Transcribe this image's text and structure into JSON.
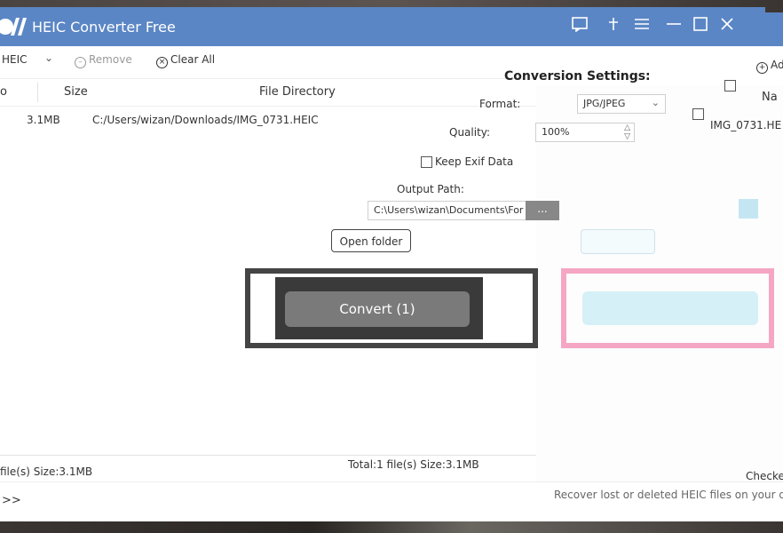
{
  "window": {
    "title": "HEIC Converter Free",
    "controls": [
      "feedback-icon",
      "pin-icon",
      "menu-icon",
      "minimize-icon",
      "maximize-icon",
      "close-icon"
    ]
  },
  "toolbar": {
    "format": "HEIC",
    "remove_label": "Remove",
    "clear_all_label": "Clear All",
    "add_file_label": "Ad"
  },
  "file_list": {
    "columns": [
      "o",
      "Size",
      "File Directory"
    ],
    "rows": [
      {
        "size": "3.1MB",
        "directory": "C:/Users/wizan/Downloads/IMG_0731.HEIC"
      }
    ]
  },
  "ghost_list": {
    "name_header": "Na",
    "row_name": "IMG_0731.HE"
  },
  "settings": {
    "title": "Conversion Settings:",
    "format_label": "Format:",
    "format_value": "JPG/JPEG",
    "quality_label": "Quality:",
    "quality_value": "100%",
    "keep_exif_label": "Keep Exif Data",
    "output_path_label": "Output Path:",
    "output_path_value": "C:\\Users\\wizan\\Documents\\For",
    "more_label": "...",
    "open_folder_label": "Open folder",
    "convert_label": "Convert (1)"
  },
  "status": {
    "left": "file(s) Size:3.1MB",
    "total": "Total:1 file(s) Size:3.1MB",
    "checked": "Checked"
  },
  "footer": {
    "expand": ">>",
    "recover_text": "Recover lost or deleted HEIC files on your devic"
  },
  "colors": {
    "titlebar": "#5b86c5",
    "convert_button": "#7a7a7a",
    "highlight": "#f5a6c4"
  }
}
